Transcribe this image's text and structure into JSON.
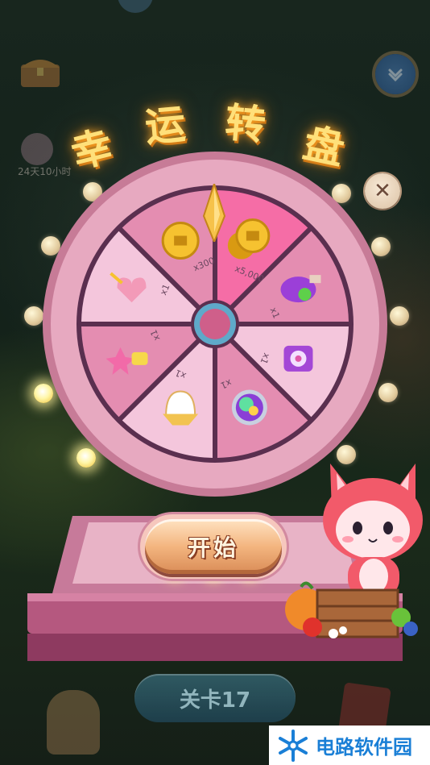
{
  "title": [
    "幸",
    "运",
    "转",
    "盘"
  ],
  "wheel": {
    "segments": [
      {
        "prize": "gold-coins",
        "label": "x5,000",
        "highlighted": true
      },
      {
        "prize": "magic-potion",
        "label": "x1"
      },
      {
        "prize": "flower-box",
        "label": "x1"
      },
      {
        "prize": "rainbow-orb",
        "label": "x1"
      },
      {
        "prize": "ghost-cake",
        "label": "x1"
      },
      {
        "prize": "star-wand",
        "label": "x1"
      },
      {
        "prize": "heart-wand",
        "label": "x1"
      },
      {
        "prize": "gold-coin",
        "label": "x300"
      }
    ]
  },
  "start_button": {
    "label": "开始"
  },
  "level_button": {
    "label": "关卡17"
  },
  "timer_text": "24天10小时",
  "watermark": {
    "text": "电路软件园"
  },
  "colors": {
    "title": "#ffe07a",
    "wheel_rim": "#e7a9c0",
    "segment_light": "#f4c6dc",
    "segment_dark": "#e48db1",
    "segment_highlight": "#f56da6",
    "watermark_blue": "#1a7fd6"
  }
}
